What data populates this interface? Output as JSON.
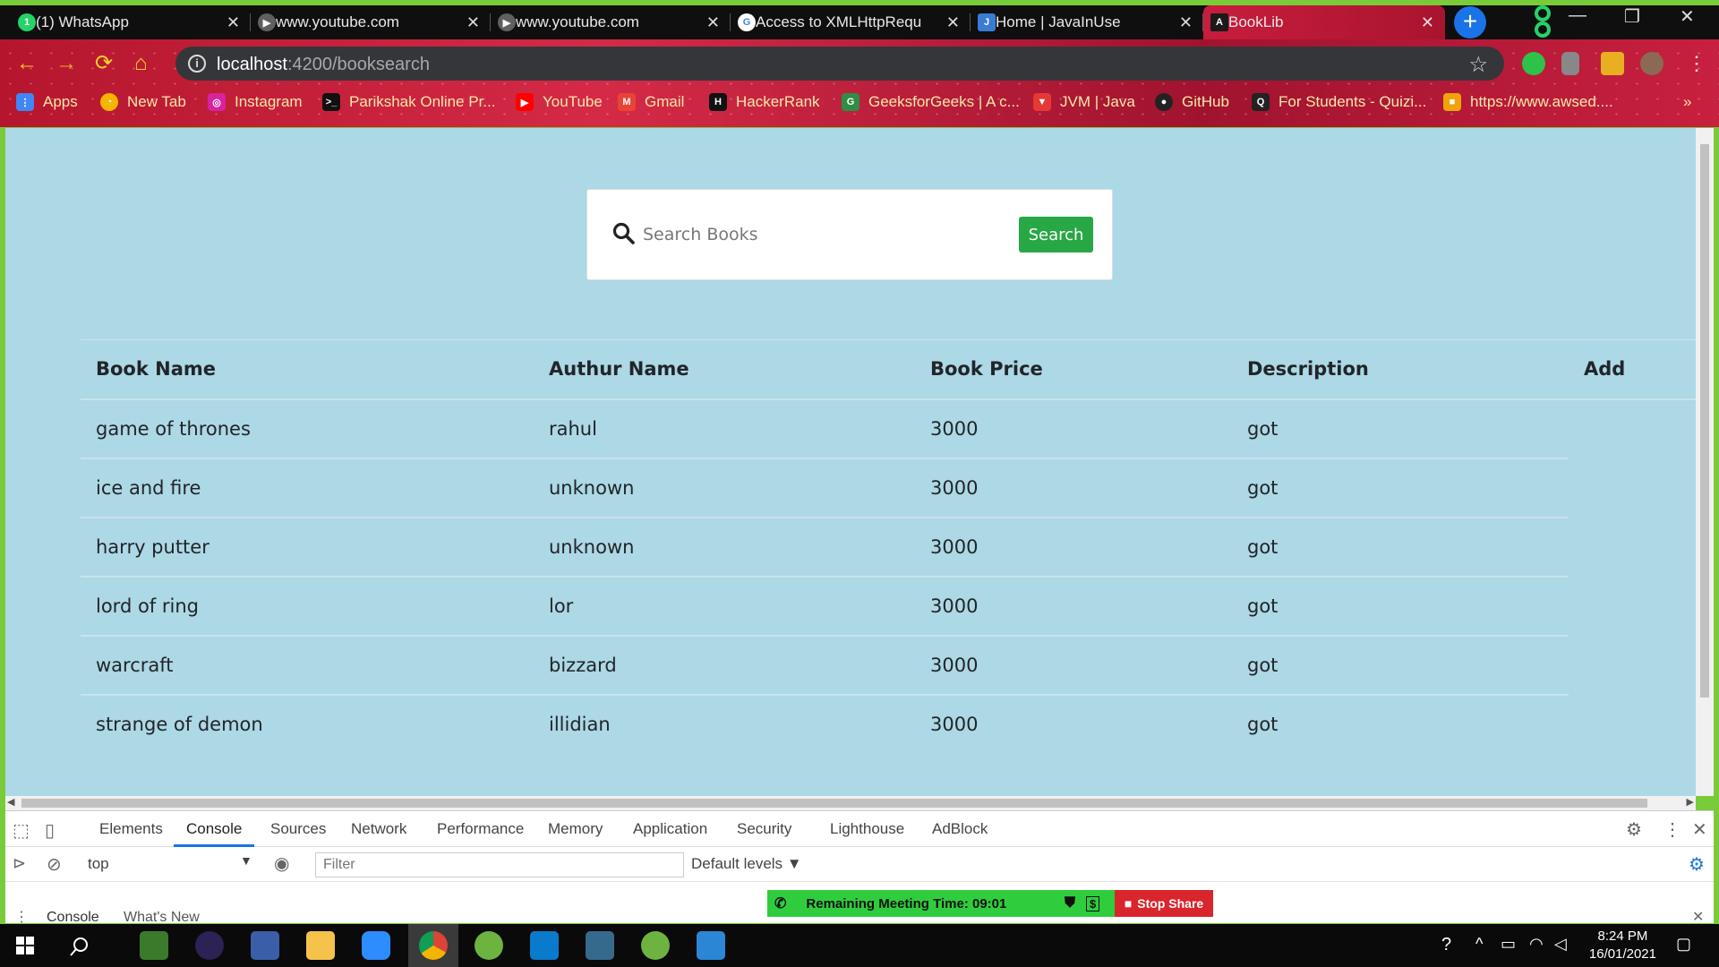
{
  "browser": {
    "tabs": [
      {
        "title": "(1) WhatsApp",
        "color": "#25d366",
        "glyph": "1"
      },
      {
        "title": "www.youtube.com",
        "color": "#606060",
        "glyph": "▶"
      },
      {
        "title": "www.youtube.com",
        "color": "#606060",
        "glyph": "▶"
      },
      {
        "title": "Access to XMLHttpRequ",
        "color": "#ffffff",
        "glyph": "G"
      },
      {
        "title": "Home | JavaInUse",
        "color": "#3a7bd5",
        "glyph": "J"
      },
      {
        "title": "BookLib",
        "color": "#1a1a1a",
        "glyph": "A"
      }
    ],
    "url_host": "localhost",
    "url_path": ":4200/booksearch",
    "bookmarks": [
      {
        "label": "Apps",
        "color": "#4285f4",
        "glyph": "⋮"
      },
      {
        "label": "New Tab",
        "color": "#f4b400",
        "glyph": "◔"
      },
      {
        "label": "Instagram",
        "color": "#d6249f",
        "glyph": "◎"
      },
      {
        "label": "Parikshak Online Pr...",
        "color": "#111111",
        "glyph": ">_"
      },
      {
        "label": "YouTube",
        "color": "#ff0000",
        "glyph": "▶"
      },
      {
        "label": "Gmail",
        "color": "#ea4335",
        "glyph": "M"
      },
      {
        "label": "HackerRank",
        "color": "#111111",
        "glyph": "H"
      },
      {
        "label": "GeeksforGeeks | A c...",
        "color": "#2f8d46",
        "glyph": "G"
      },
      {
        "label": "JVM | Java",
        "color": "#e53935",
        "glyph": "▼"
      },
      {
        "label": "GitHub",
        "color": "#222222",
        "glyph": "●"
      },
      {
        "label": "For Students - Quizi...",
        "color": "#222222",
        "glyph": "Q"
      },
      {
        "label": "https://www.awsed....",
        "color": "#f0a30a",
        "glyph": "■"
      }
    ]
  },
  "search": {
    "placeholder": "Search Books",
    "button_label": "Search"
  },
  "table": {
    "headers": [
      "Book Name",
      "Authur Name",
      "Book Price",
      "Description",
      "Add"
    ],
    "rows": [
      [
        "game of thrones",
        "rahul",
        "3000",
        "got"
      ],
      [
        "ice and fire",
        "unknown",
        "3000",
        "got"
      ],
      [
        "harry putter",
        "unknown",
        "3000",
        "got"
      ],
      [
        "lord of ring",
        "lor",
        "3000",
        "got"
      ],
      [
        "warcraft",
        "bizzard",
        "3000",
        "got"
      ],
      [
        "strange of demon",
        "illidian",
        "3000",
        "got"
      ]
    ]
  },
  "devtools": {
    "tabs": [
      "Elements",
      "Console",
      "Sources",
      "Network",
      "Performance",
      "Memory",
      "Application",
      "Security",
      "Lighthouse",
      "AdBlock"
    ],
    "active_tab": "Console",
    "context": "top",
    "filter_placeholder": "Filter",
    "levels": "Default levels ▼",
    "drawer_tabs": [
      "Console",
      "What's New"
    ]
  },
  "meeting": {
    "text": "Remaining Meeting Time: 09:01",
    "stop_label": "Stop Share"
  },
  "taskbar": {
    "time": "8:24 PM",
    "date": "16/01/2021"
  }
}
